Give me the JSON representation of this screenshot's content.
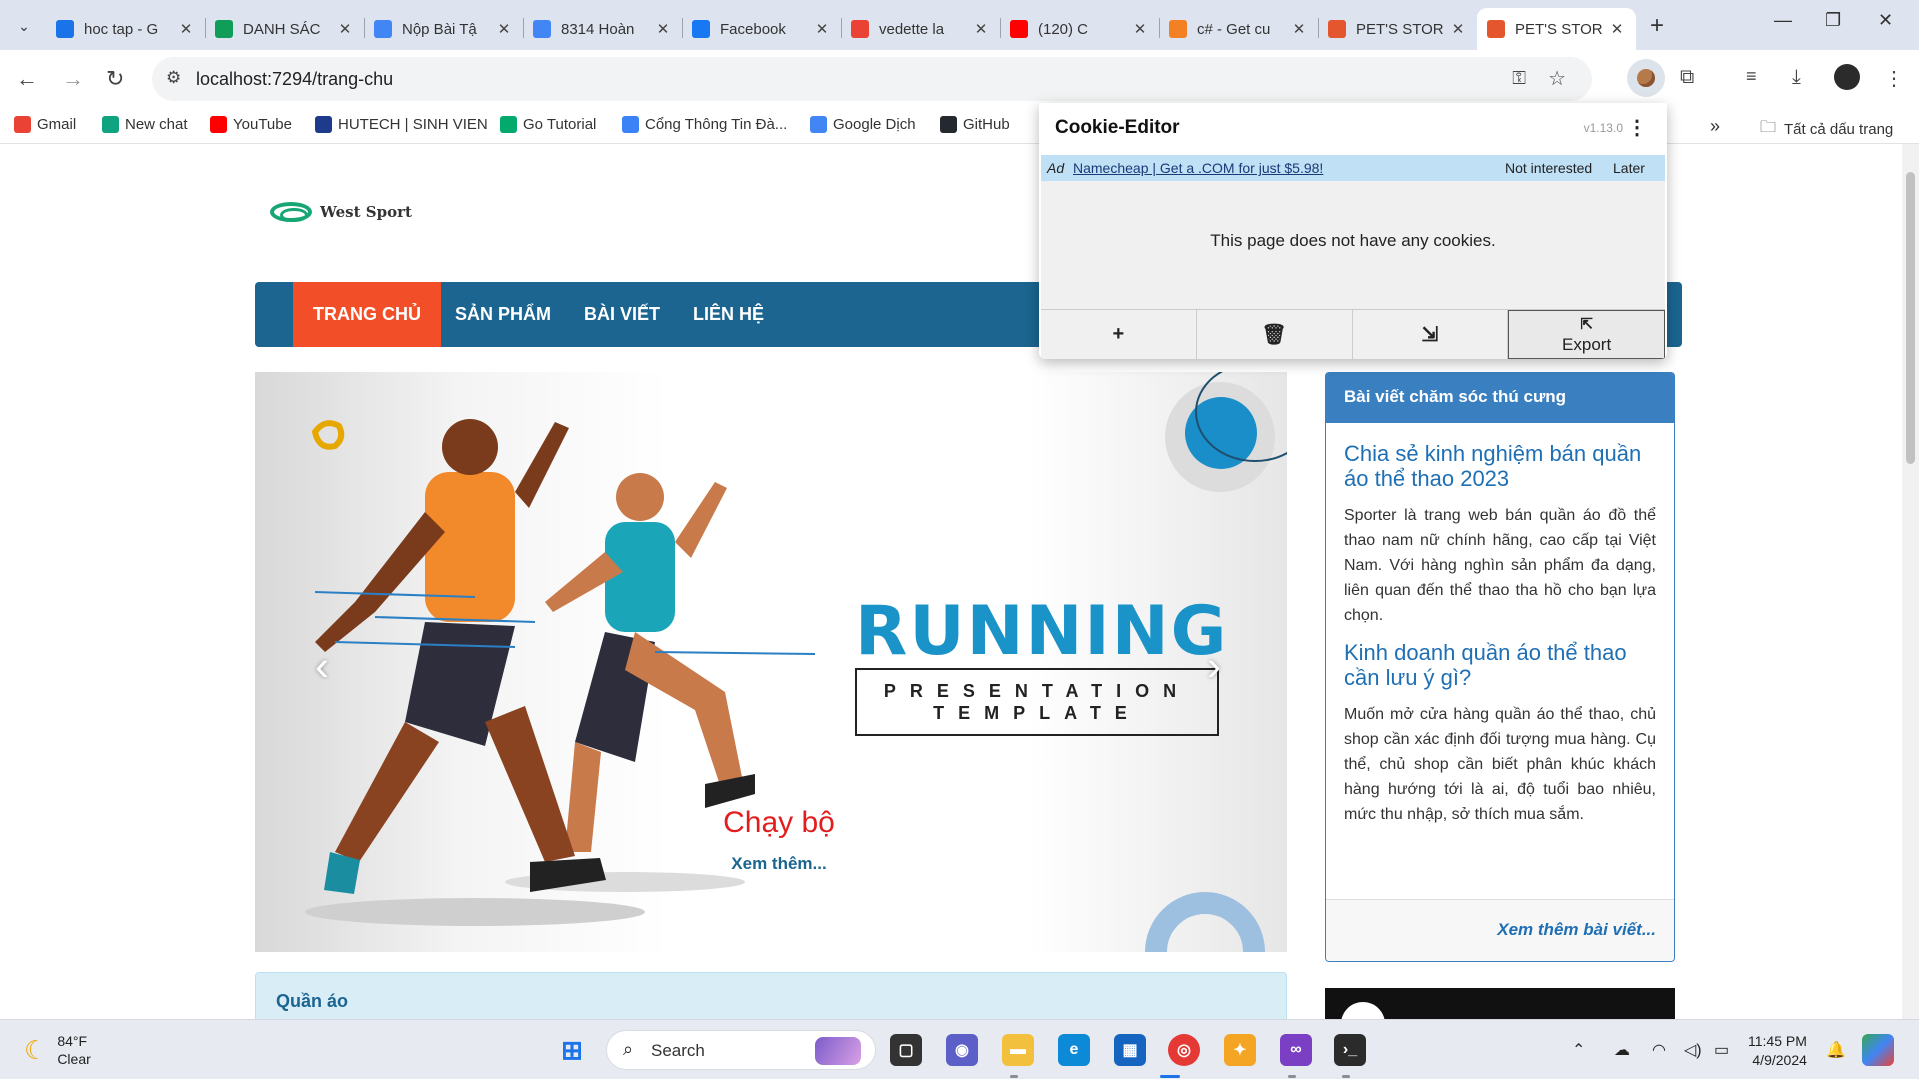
{
  "browser": {
    "tabs": [
      {
        "title": "hoc tap - G",
        "icon": "google-drive-icon",
        "color": "#1a73e8"
      },
      {
        "title": "DANH SÁC",
        "icon": "google-sheets-icon",
        "color": "#0f9d58"
      },
      {
        "title": "Nộp Bài Tậ",
        "icon": "classroom-icon",
        "color": "#4285f4"
      },
      {
        "title": "8314 Hoàn",
        "icon": "google-docs-icon",
        "color": "#4285f4"
      },
      {
        "title": "Facebook",
        "icon": "facebook-icon",
        "color": "#1877f2"
      },
      {
        "title": "vedette la",
        "icon": "google-icon",
        "color": "#ea4335"
      },
      {
        "title": "(120) C",
        "icon": "youtube-icon",
        "color": "#ff0000"
      },
      {
        "title": "c# - Get cu",
        "icon": "stackoverflow-icon",
        "color": "#f48024"
      },
      {
        "title": "PET'S STOR",
        "icon": "pets-store-icon",
        "color": "#e4572e"
      },
      {
        "title": "PET'S STOR",
        "icon": "pets-store-icon",
        "color": "#e4572e"
      }
    ],
    "active_tab_index": 9,
    "url": "localhost:7294/trang-chu",
    "bookmarks": [
      {
        "label": "Gmail",
        "icon": "gmail-icon",
        "color": "#ea4335"
      },
      {
        "label": "New chat",
        "icon": "chatgpt-icon",
        "color": "#10a37f"
      },
      {
        "label": "YouTube",
        "icon": "youtube-icon",
        "color": "#ff0000"
      },
      {
        "label": "HUTECH | SINH VIEN",
        "icon": "hutech-icon",
        "color": "#1e3a8a"
      },
      {
        "label": "Go Tutorial",
        "icon": "w3-icon",
        "color": "#04aa6d"
      },
      {
        "label": "Cổng Thông Tin Đà...",
        "icon": "portal-icon",
        "color": "#3b82f6"
      },
      {
        "label": "Google Dịch",
        "icon": "google-translate-icon",
        "color": "#4285f4"
      },
      {
        "label": "GitHub",
        "icon": "github-icon",
        "color": "#24292f"
      }
    ],
    "all_bookmarks": "Tất cả dấu trang"
  },
  "site": {
    "logo_text": "West Sport",
    "nav": [
      "TRANG CHỦ",
      "SẢN PHẨM",
      "BÀI VIẾT",
      "LIÊN HỆ"
    ],
    "active_nav": "TRANG CHỦ",
    "slide": {
      "headline": "RUNNING",
      "subline_1": "PRESENTATION",
      "subline_2": "TEMPLATE",
      "caption": "Chạy bộ",
      "caption_link": "Xem thêm..."
    },
    "section_title": "Quần áo",
    "sidebar": {
      "heading": "Bài viết chăm sóc thú cưng",
      "articles": [
        {
          "title": "Chia sẻ kinh nghiệm bán quần áo thể thao 2023",
          "text": "Sporter là trang web bán quần áo đồ thể thao nam nữ chính hãng, cao cấp tại Việt Nam. Với hàng nghìn sản phẩm đa dạng, liên quan đến thể thao tha hồ cho bạn lựa chọn."
        },
        {
          "title": "Kinh doanh quần áo thể thao cần lưu ý gì?",
          "text": "Muốn mở cửa hàng quần áo thể thao, chủ shop cần xác định đối tượng mua hàng. Cụ thể, chủ shop cần biết phân khúc khách hàng hướng tới là ai, độ tuổi bao nhiêu, mức thu nhập, sở thích mua sắm."
        }
      ],
      "more_link": "Xem thêm bài viết..."
    },
    "colors": {
      "nav_bg": "#1b6590",
      "nav_active": "#f24e27",
      "accent_blue": "#1a93c9"
    }
  },
  "cookie_editor": {
    "title": "Cookie-Editor",
    "version": "v1.13.0",
    "ad_label": "Ad",
    "ad_text": "Namecheap | Get a .COM for just $5.98!",
    "not_interested": "Not interested",
    "later": "Later",
    "message": "This page does not have any cookies.",
    "export_label": "Export"
  },
  "taskbar": {
    "weather_temp": "84°F",
    "weather_desc": "Clear",
    "search_placeholder": "Search",
    "time": "11:45 PM",
    "date": "4/9/2024"
  }
}
